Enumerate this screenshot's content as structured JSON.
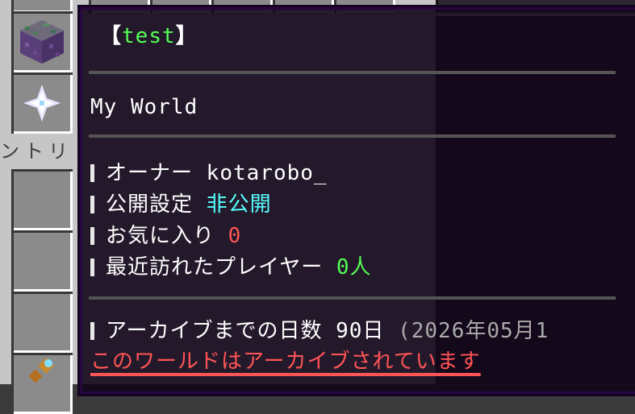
{
  "inventory": {
    "side_label": "ントリ"
  },
  "tooltip": {
    "title_open": "【",
    "title": "test",
    "title_close": "】",
    "world_name": "My World",
    "owner": {
      "label": "オーナー",
      "value": "kotarobo_"
    },
    "visibility": {
      "label": "公開設定",
      "value": "非公開"
    },
    "favorites": {
      "label": "お気に入り",
      "value": "0"
    },
    "recent_players": {
      "label": "最近訪れたプレイヤー",
      "value": "0人"
    },
    "archive_days": {
      "label": "アーカイブまでの日数",
      "value": "90日",
      "date": "(2026年05月1"
    },
    "archived_notice": "このワールドはアーカイブされています"
  },
  "colors": {
    "title": "#55ff55",
    "visibility_value": "#55ffff",
    "favorites_value": "#ff5555",
    "recent_value": "#55ff55",
    "archived_notice": "#ff5555",
    "tooltip_bg": "#12061a"
  }
}
